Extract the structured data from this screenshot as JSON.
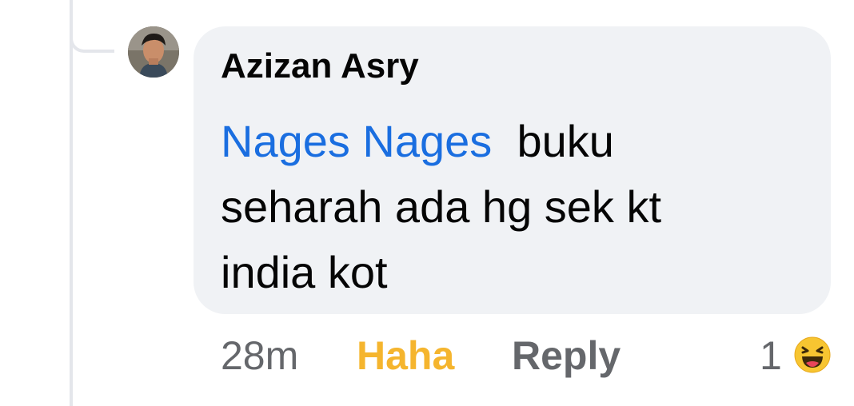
{
  "comment": {
    "author": "Azizan Asry",
    "mention": "Nages Nages",
    "body_line1": "buku",
    "body_line2": "seharah ada hg sek kt",
    "body_line3": "india kot"
  },
  "meta": {
    "time": "28m",
    "reaction_action": "Haha",
    "reply": "Reply",
    "reaction_count": "1"
  },
  "icons": {
    "reaction": "haha-emoji-icon",
    "avatar": "profile-photo"
  },
  "colors": {
    "bubble": "#f0f2f5",
    "mention": "#1a6ee0",
    "haha": "#f5b52e",
    "meta": "#65676b"
  }
}
